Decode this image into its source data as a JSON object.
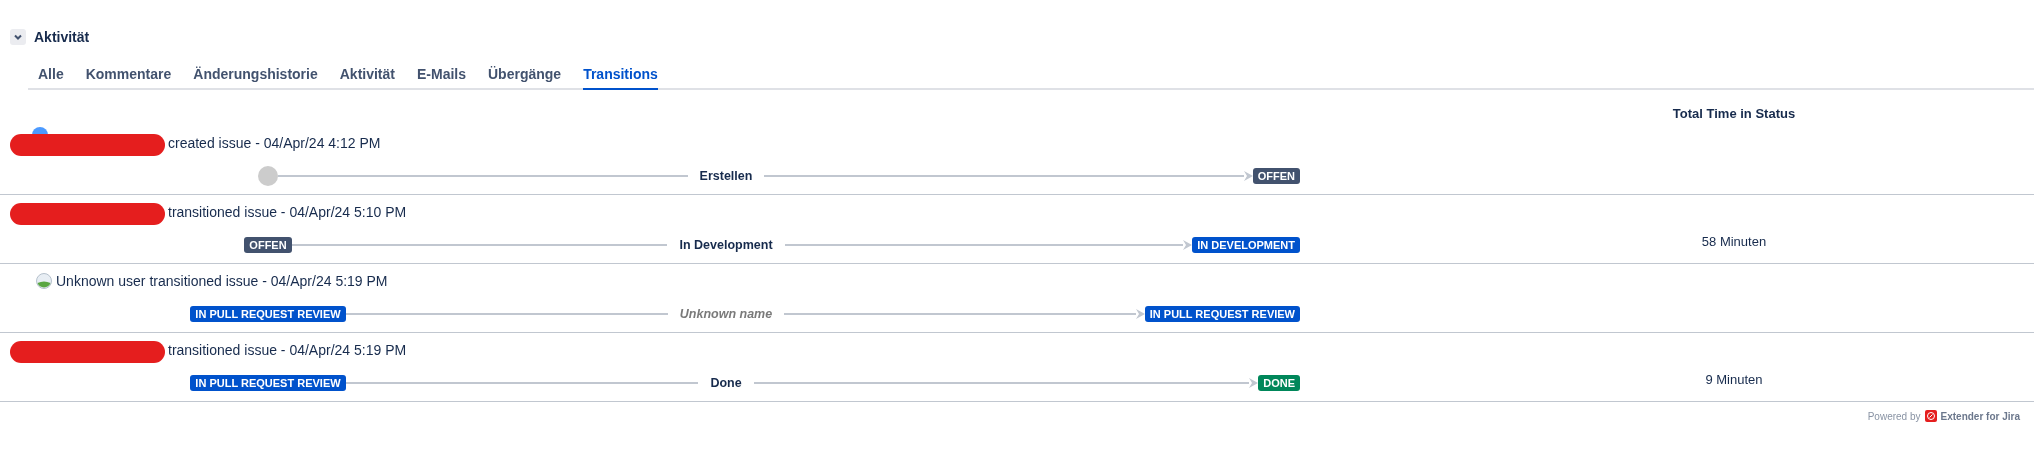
{
  "section": {
    "title": "Aktivität",
    "expanded": true
  },
  "tabs": [
    {
      "label": "Alle",
      "selected": false
    },
    {
      "label": "Kommentare",
      "selected": false
    },
    {
      "label": "Änderungshistorie",
      "selected": false
    },
    {
      "label": "Aktivität",
      "selected": false
    },
    {
      "label": "E-Mails",
      "selected": false
    },
    {
      "label": "Übergänge",
      "selected": false
    },
    {
      "label": "Transitions",
      "selected": true
    }
  ],
  "time_header": "Total Time in Status",
  "rows": [
    {
      "redacted": true,
      "avatar": true,
      "action": "created issue - 04/Apr/24 4:12 PM",
      "from": {
        "kind": "start"
      },
      "transition": {
        "label": "Erstellen",
        "unknown": false
      },
      "to": {
        "kind": "status",
        "label": "OFFEN",
        "color": "#42526e"
      }
    },
    {
      "redacted": true,
      "action": "transitioned issue - 04/Apr/24 5:10 PM",
      "from": {
        "kind": "status",
        "label": "OFFEN",
        "color": "#42526e"
      },
      "transition": {
        "label": "In Development",
        "unknown": false
      },
      "to": {
        "kind": "status",
        "label": "IN DEVELOPMENT",
        "color": "#0052cc"
      },
      "time": "58 Minuten"
    },
    {
      "redacted": false,
      "avatar": true,
      "actor": "Unknown user",
      "action": "transitioned issue - 04/Apr/24 5:19 PM",
      "from": {
        "kind": "status",
        "label": "IN PULL REQUEST REVIEW",
        "color": "#0052cc"
      },
      "transition": {
        "label": "Unknown name",
        "unknown": true
      },
      "to": {
        "kind": "status",
        "label": "IN PULL REQUEST REVIEW",
        "color": "#0052cc"
      }
    },
    {
      "redacted": true,
      "action": "transitioned issue - 04/Apr/24 5:19 PM",
      "from": {
        "kind": "status",
        "label": "IN PULL REQUEST REVIEW",
        "color": "#0052cc"
      },
      "transition": {
        "label": "Done",
        "unknown": false
      },
      "to": {
        "kind": "status",
        "label": "DONE",
        "color": "#00875a"
      },
      "time": "9 Minuten"
    }
  ],
  "footer": {
    "prefix": "Powered by",
    "brand": "Extender for Jira"
  }
}
